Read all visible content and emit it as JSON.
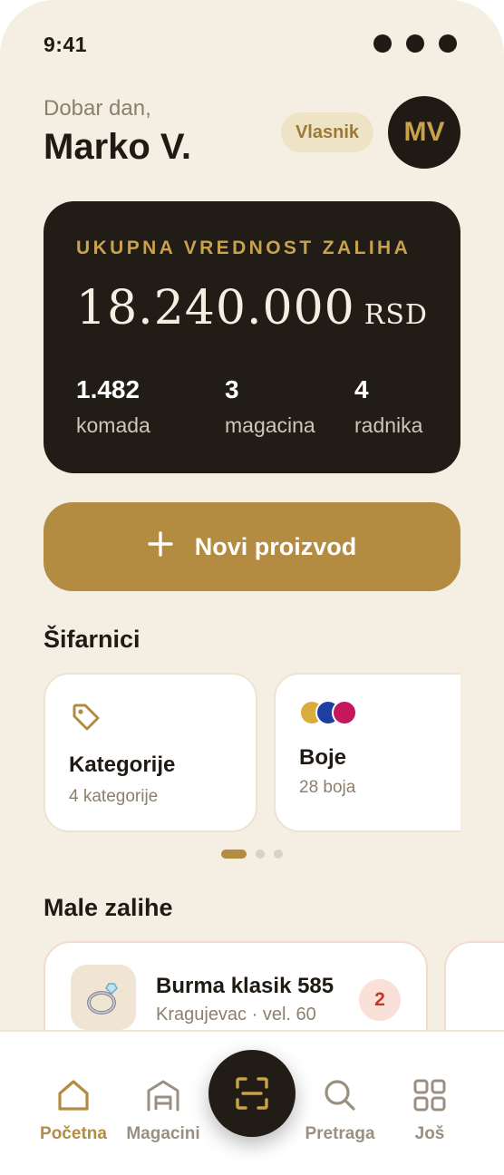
{
  "status_bar": {
    "time": "9:41"
  },
  "header": {
    "greeting": "Dobar dan,",
    "user_name": "Marko V.",
    "role": "Vlasnik",
    "avatar_initials": "MV"
  },
  "inventory_card": {
    "label": "UKUPNA VREDNOST ZALIHA",
    "amount": "18.240.000",
    "currency": "RSD",
    "stats": [
      {
        "value": "1.482",
        "label": "komada"
      },
      {
        "value": "3",
        "label": "magacina"
      },
      {
        "value": "4",
        "label": "radnika"
      }
    ]
  },
  "new_product_button": {
    "label": "Novi proizvod",
    "icon": "plus-icon"
  },
  "catalogs": {
    "title": "Šifarnici",
    "items": [
      {
        "title": "Kategorije",
        "subtitle": "4 kategorije",
        "icon": "tag-icon"
      },
      {
        "title": "Boje",
        "subtitle": "28 boja",
        "icon": "color-dots-icon",
        "colors": [
          "#d9ac3c",
          "#1d3fa3",
          "#c6175c"
        ]
      }
    ],
    "pager": {
      "pages": 3,
      "active": 0
    }
  },
  "low_stock": {
    "title": "Male zalihe",
    "items": [
      {
        "name": "Burma klasik 585",
        "meta": "Kragujevac · vel. 60",
        "quantity": "2",
        "icon": "ring-icon"
      }
    ]
  },
  "tab_bar": {
    "items": [
      {
        "label": "Početna",
        "icon": "home-icon",
        "active": true
      },
      {
        "label": "Magacini",
        "icon": "warehouse-icon",
        "active": false
      },
      {
        "label": "",
        "icon": "scan-icon",
        "active": false
      },
      {
        "label": "Pretraga",
        "icon": "search-icon",
        "active": false
      },
      {
        "label": "Još",
        "icon": "grid-icon",
        "active": false
      }
    ]
  },
  "colors": {
    "background": "#f5efe3",
    "accent": "#b38c42",
    "dark": "#221c16",
    "gold_text": "#c9a24d",
    "alert": "#c0392b"
  }
}
